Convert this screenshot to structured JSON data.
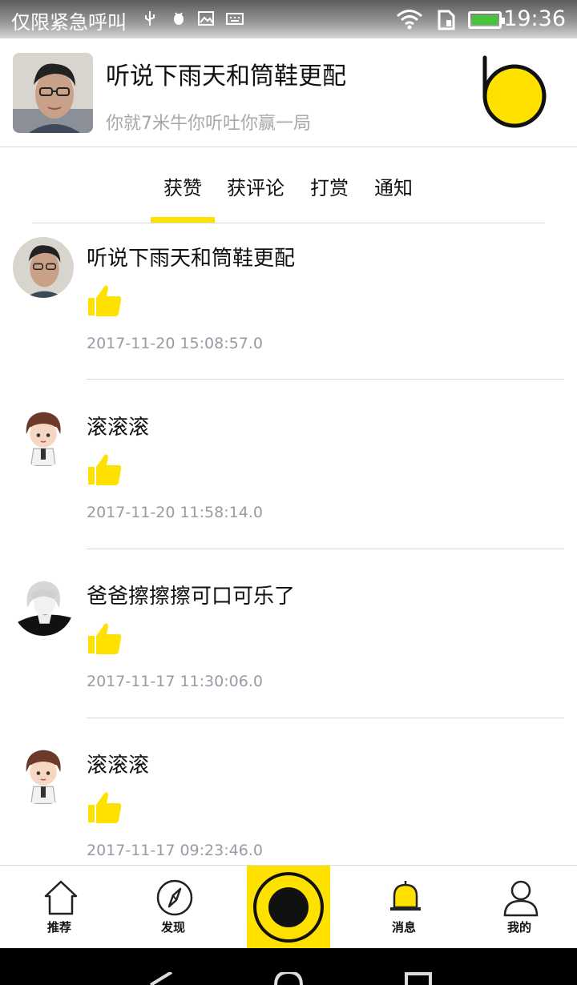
{
  "status_bar": {
    "carrier": "仅限紧急呼叫",
    "time": "19:36",
    "icons": [
      "usb-icon",
      "android-debug-icon",
      "image-icon",
      "keyboard-icon",
      "wifi-icon",
      "sim-icon",
      "battery-icon"
    ]
  },
  "header": {
    "title": "听说下雨天和筒鞋更配",
    "subtitle": "你就7米牛你听吐你赢一局"
  },
  "tabs": [
    {
      "label": "获赞",
      "active": true
    },
    {
      "label": "获评论",
      "active": false
    },
    {
      "label": "打赏",
      "active": false
    },
    {
      "label": "通知",
      "active": false
    }
  ],
  "notifications": [
    {
      "name": "听说下雨天和筒鞋更配",
      "icon": "thumbs-up-icon",
      "time": "2017-11-20 15:08:57.0",
      "avatar": "photo-man"
    },
    {
      "name": "滚滚滚",
      "icon": "thumbs-up-icon",
      "time": "2017-11-20 11:58:14.0",
      "avatar": "cartoon-boy"
    },
    {
      "name": "爸爸擦擦擦可口可乐了",
      "icon": "thumbs-up-icon",
      "time": "2017-11-17 11:30:06.0",
      "avatar": "anime-white-hair"
    },
    {
      "name": "滚滚滚",
      "icon": "thumbs-up-icon",
      "time": "2017-11-17 09:23:46.0",
      "avatar": "cartoon-boy"
    }
  ],
  "bottom_nav": [
    {
      "label": "推荐",
      "icon": "home-icon"
    },
    {
      "label": "发现",
      "icon": "compass-icon"
    },
    {
      "label": "",
      "icon": "record-button-icon"
    },
    {
      "label": "消息",
      "icon": "bell-icon"
    },
    {
      "label": "我的",
      "icon": "person-icon"
    }
  ],
  "colors": {
    "accent": "#ffe100",
    "text": "#111111",
    "muted": "#9a9aa6"
  }
}
